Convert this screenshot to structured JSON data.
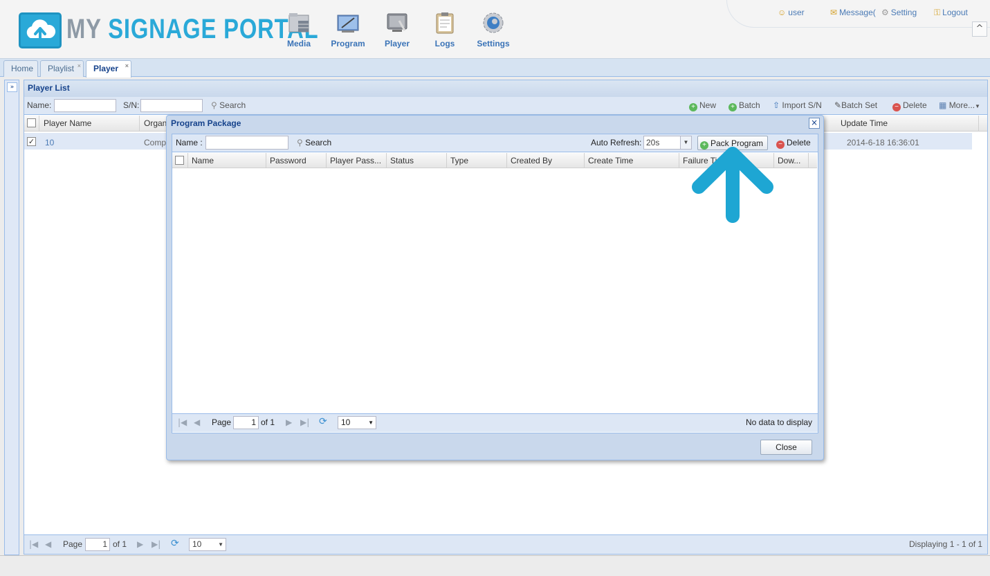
{
  "header": {
    "logo_my": "MY",
    "logo_rest": "SIGNAGE PORTAL",
    "nav": [
      {
        "label": "Media",
        "icon": "media-icon"
      },
      {
        "label": "Program",
        "icon": "program-icon"
      },
      {
        "label": "Player",
        "icon": "player-icon"
      },
      {
        "label": "Logs",
        "icon": "logs-icon"
      },
      {
        "label": "Settings",
        "icon": "settings-icon"
      }
    ],
    "user_label": "user",
    "message_label": "Message(",
    "setting_label": "Setting",
    "logout_label": "Logout",
    "collapse_glyph": "^"
  },
  "tabs": [
    {
      "label": "Home",
      "closable": false
    },
    {
      "label": "Playlist",
      "closable": true
    },
    {
      "label": "Player",
      "closable": true,
      "active": true
    }
  ],
  "tab_close_glyph": "×",
  "player_list": {
    "title": "Player List",
    "name_label": "Name:",
    "sn_label": "S/N:",
    "search_label": "Search",
    "new_label": "New",
    "batch_label": "Batch",
    "import_label": "Import S/N",
    "batch_set_label": "Batch Set",
    "delete_label": "Delete",
    "more_label": "More...",
    "columns": {
      "player_name": "Player Name",
      "organ": "Organ",
      "update_time": "Update Time"
    },
    "rows": [
      {
        "player_name": "10",
        "organ": "Comp",
        "update_time": "2014-6-18 16:36:01",
        "checked": true
      }
    ],
    "pager": {
      "page_label": "Page",
      "page_value": "1",
      "of_label": "of 1",
      "page_size": "10",
      "display_text": "Displaying 1 - 1 of 1"
    }
  },
  "dialog": {
    "title": "Program Package",
    "close_glyph": "×",
    "name_label": "Name :",
    "search_label": "Search",
    "auto_refresh_label": "Auto Refresh:",
    "auto_refresh_value": "20s",
    "pack_program_label": "Pack Program",
    "delete_label": "Delete",
    "columns": [
      "Name",
      "Password",
      "Player Pass...",
      "Status",
      "Type",
      "Created By",
      "Create Time",
      "Failure Ti",
      "Dow..."
    ],
    "pager": {
      "page_label": "Page",
      "page_value": "1",
      "of_label": "of 1",
      "page_size": "10",
      "empty_text": "No data to display"
    },
    "close_button": "Close"
  },
  "colors": {
    "accent": "#2aa9d8",
    "header_blue": "#15428b",
    "nav_blue": "#3a73b7",
    "arrow": "#1ea6d3"
  }
}
